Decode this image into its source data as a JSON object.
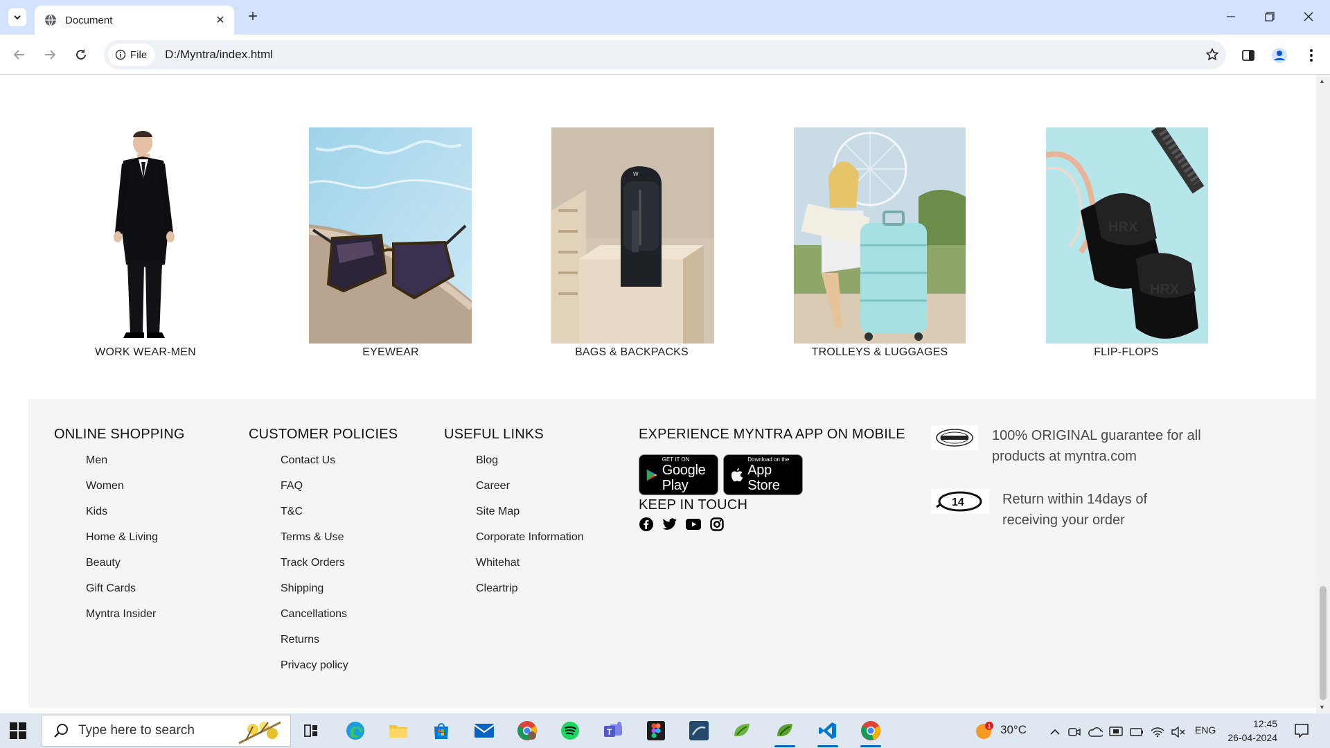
{
  "browser": {
    "tab_title": "Document",
    "url_chip": "File",
    "url": "D:/Myntra/index.html"
  },
  "categories": [
    {
      "label": "WORK WEAR-MEN",
      "icon": "suit-man-image"
    },
    {
      "label": "EYEWEAR",
      "icon": "sunglasses-image"
    },
    {
      "label": "BAGS & BACKPACKS",
      "icon": "backpack-image"
    },
    {
      "label": "TROLLEYS & LUGGAGES",
      "icon": "trolley-image"
    },
    {
      "label": "FLIP-FLOPS",
      "icon": "flipflops-image"
    }
  ],
  "footer": {
    "online_shopping": {
      "title": "ONLINE SHOPPING",
      "items": [
        "Men",
        "Women",
        "Kids",
        "Home & Living",
        "Beauty",
        "Gift Cards",
        "Myntra Insider"
      ]
    },
    "customer_policies": {
      "title": "CUSTOMER POLICIES",
      "items": [
        "Contact Us",
        "FAQ",
        "T&C",
        "Terms & Use",
        "Track Orders",
        "Shipping",
        "Cancellations",
        "Returns",
        "Privacy policy"
      ]
    },
    "useful_links": {
      "title": "USEFUL LINKS",
      "items": [
        "Blog",
        "Career",
        "Site Map",
        "Corporate Information",
        "Whitehat",
        "Cleartrip"
      ]
    },
    "app": {
      "title": "EXPERIENCE MYNTRA APP ON MOBILE",
      "google_small": "GET IT ON",
      "google_big": "Google Play",
      "apple_small": "Download on the",
      "apple_big": "App Store"
    },
    "keep_in_touch": {
      "title": "KEEP IN TOUCH",
      "icons": [
        "facebook-icon",
        "twitter-icon",
        "youtube-icon",
        "instagram-icon"
      ]
    },
    "guarantees": [
      {
        "badge": "ORIGINAL",
        "text": "100% ORIGINAL guarantee for all products at myntra.com"
      },
      {
        "badge": "14",
        "text": "Return within 14days of receiving your order"
      }
    ]
  },
  "taskbar": {
    "search_placeholder": "Type here to search",
    "weather": "30°C",
    "weather_badge": "1",
    "language": "ENG",
    "time": "12:45",
    "date": "26-04-2024"
  }
}
